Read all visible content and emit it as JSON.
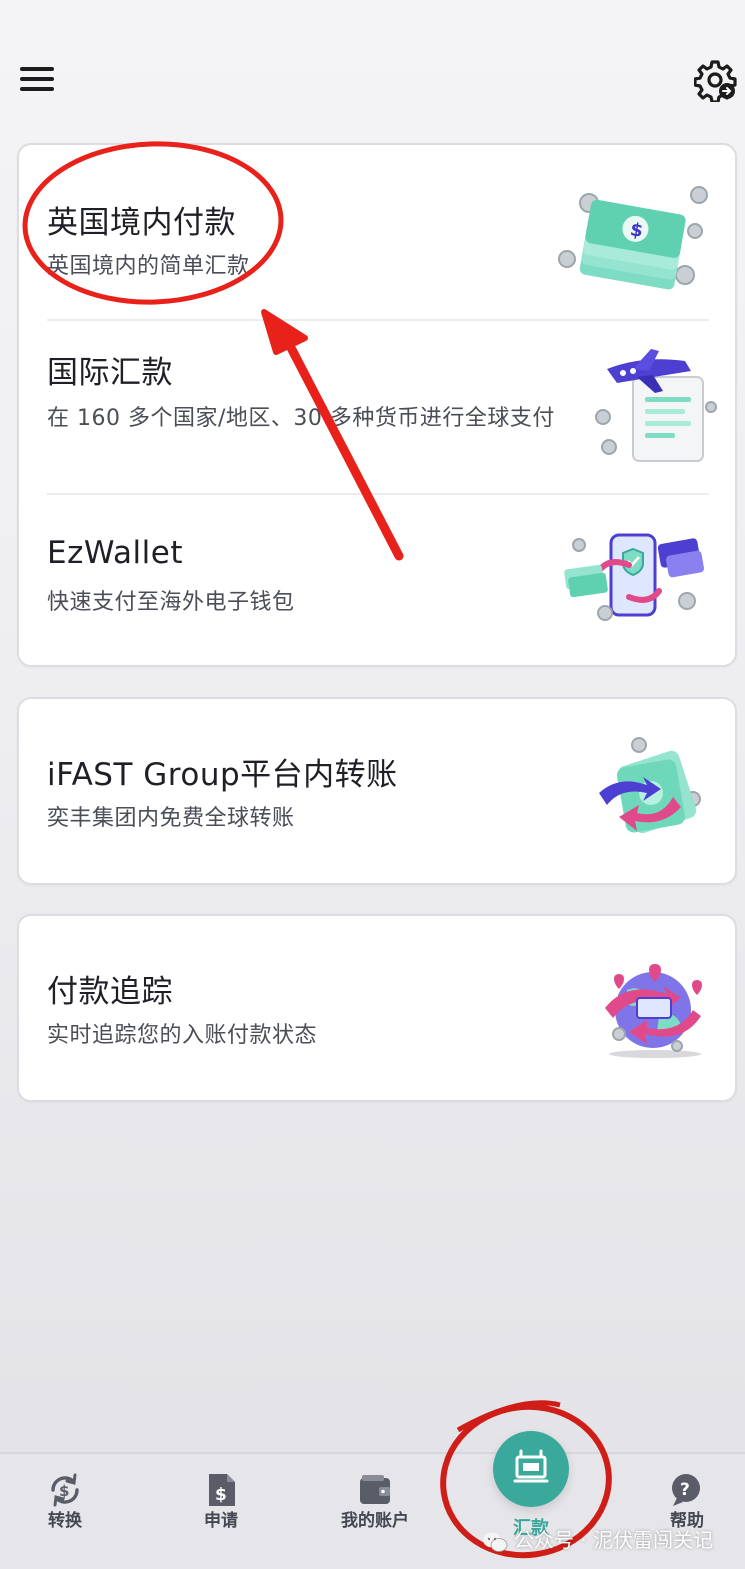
{
  "header": {
    "menu_icon": "hamburger-menu-icon",
    "settings_icon": "gear-settings-icon"
  },
  "cards": [
    {
      "items": [
        {
          "title": "英国境内付款",
          "subtitle": "英国境内的简单汇款",
          "illustration": "money-stack-illustration"
        },
        {
          "title": "国际汇款",
          "subtitle": "在 160 多个国家/地区、30 多种货币进行全球支付",
          "illustration": "airplane-receipt-illustration"
        },
        {
          "title": "EzWallet",
          "subtitle": "快速支付至海外电子钱包",
          "illustration": "phone-wallet-illustration"
        }
      ]
    },
    {
      "items": [
        {
          "title": "iFAST Group平台内转账",
          "subtitle": "奕丰集团内免费全球转账",
          "illustration": "transfer-arrows-illustration"
        }
      ]
    },
    {
      "items": [
        {
          "title": "付款追踪",
          "subtitle": "实时追踪您的入账付款状态",
          "illustration": "globe-tracking-illustration"
        }
      ]
    }
  ],
  "bottom_nav": {
    "items": [
      {
        "label": "转换",
        "icon": "currency-exchange-icon"
      },
      {
        "label": "申请",
        "icon": "dollar-document-icon"
      },
      {
        "label": "我的账户",
        "icon": "wallet-icon"
      },
      {
        "label": "汇款",
        "icon": "send-money-icon",
        "active": true
      },
      {
        "label": "帮助",
        "icon": "help-chat-icon"
      }
    ]
  },
  "watermark": {
    "text": "公众号 · 泥伏雷闯关记",
    "icon": "wechat-icon"
  },
  "colors": {
    "accent": "#3aa99b",
    "annotation": "#e8221b",
    "text_primary": "#1f2027",
    "text_secondary": "#4b4d57"
  }
}
